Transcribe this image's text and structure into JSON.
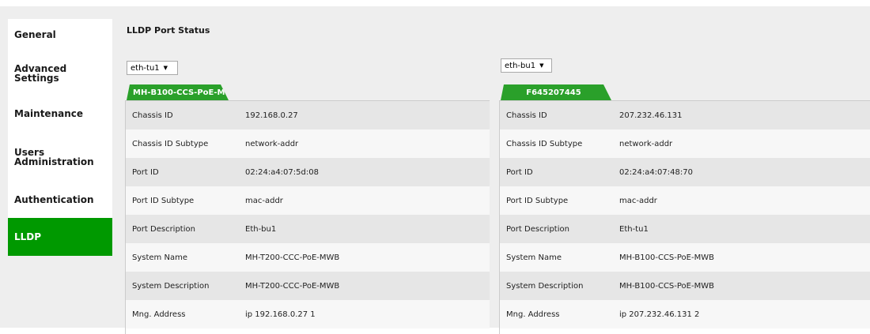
{
  "nav": {
    "items": [
      {
        "label": "General"
      },
      {
        "label": "Advanced Settings"
      },
      {
        "label": "Maintenance"
      },
      {
        "label": "Users Administration"
      },
      {
        "label": "Authentication"
      },
      {
        "label": "LLDP",
        "active": true
      }
    ]
  },
  "title": "LLDP Port Status",
  "ports": [
    {
      "select_value": "eth-tu1",
      "tab_label": "MH-B100-CCS-PoE-M...",
      "rows": [
        {
          "label": "Chassis ID",
          "value": "192.168.0.27"
        },
        {
          "label": "Chassis ID Subtype",
          "value": "network-addr"
        },
        {
          "label": "Port ID",
          "value": "02:24:a4:07:5d:08"
        },
        {
          "label": "Port ID Subtype",
          "value": "mac-addr"
        },
        {
          "label": "Port Description",
          "value": "Eth-bu1"
        },
        {
          "label": "System Name",
          "value": "MH-T200-CCC-PoE-MWB"
        },
        {
          "label": "System Description",
          "value": "MH-T200-CCC-PoE-MWB"
        },
        {
          "label": "Mng. Address",
          "value": "ip 192.168.0.27 1"
        }
      ]
    },
    {
      "select_value": "eth-bu1",
      "tab_label": "F645207445",
      "rows": [
        {
          "label": "Chassis ID",
          "value": "207.232.46.131"
        },
        {
          "label": "Chassis ID Subtype",
          "value": "network-addr"
        },
        {
          "label": "Port ID",
          "value": "02:24:a4:07:48:70"
        },
        {
          "label": "Port ID Subtype",
          "value": "mac-addr"
        },
        {
          "label": "Port Description",
          "value": "Eth-tu1"
        },
        {
          "label": "System Name",
          "value": "MH-B100-CCS-PoE-MWB"
        },
        {
          "label": "System Description",
          "value": "MH-B100-CCS-PoE-MWB"
        },
        {
          "label": "Mng. Address",
          "value": "ip 207.232.46.131 2"
        }
      ]
    }
  ],
  "colors": {
    "active_nav": "#009900",
    "tab": "#2aa02a",
    "row_alt": "#e6e6e6",
    "row_plain": "#f7f7f7",
    "frame_bg": "#eeeeee"
  },
  "icons": {
    "select_arrow": "▼"
  }
}
